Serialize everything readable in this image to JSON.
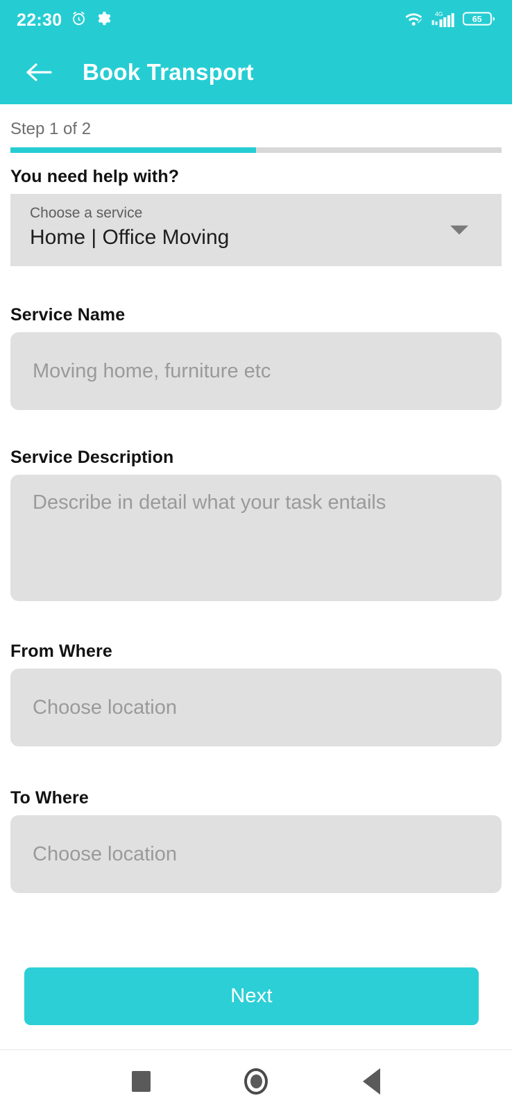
{
  "colors": {
    "accent": "#25cdd3",
    "button": "#2ccfd6",
    "field_bg": "#e0e0e0",
    "placeholder": "#9a9a9a",
    "track": "#d8d8d8"
  },
  "statusbar": {
    "time": "22:30",
    "alarm_icon": "alarm-clock-icon",
    "settings_icon": "gear-icon",
    "wifi_icon": "wifi-icon",
    "network_label": "4G",
    "signal_icon": "signal-bars-icon",
    "battery_level": "65"
  },
  "header": {
    "back_icon": "back-arrow-icon",
    "title": "Book Transport"
  },
  "progress": {
    "step_text": "Step 1 of 2",
    "current_step": 1,
    "total_steps": 2,
    "percent": 50
  },
  "form": {
    "service": {
      "label": "You need help with?",
      "float_label": "Choose a service",
      "value": "Home | Office Moving",
      "chevron_icon": "chevron-down-icon"
    },
    "service_name": {
      "label": "Service Name",
      "value": "",
      "placeholder": "Moving home, furniture etc"
    },
    "service_description": {
      "label": "Service Description",
      "value": "",
      "placeholder": "Describe in detail what your task entails"
    },
    "from_where": {
      "label": "From Where",
      "value": "",
      "placeholder": "Choose location"
    },
    "to_where": {
      "label": "To Where",
      "value": "",
      "placeholder": "Choose location"
    }
  },
  "actions": {
    "next_label": "Next"
  },
  "navbar": {
    "recents_icon": "square-recents-icon",
    "home_icon": "circle-home-icon",
    "back_icon": "triangle-back-icon"
  }
}
